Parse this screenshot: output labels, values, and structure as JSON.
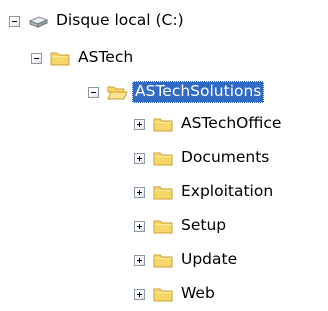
{
  "tree": {
    "root": {
      "label": "Disque local (C:)",
      "icon": "hard-drive-icon",
      "state": "expanded"
    },
    "astech": {
      "label": "ASTech",
      "icon": "folder-icon",
      "state": "expanded"
    },
    "astechsolutions": {
      "label": "ASTechSolutions",
      "icon": "open-folder-icon",
      "state": "expanded",
      "selected": true
    },
    "children": [
      {
        "label": "ASTechOffice",
        "icon": "folder-icon",
        "state": "collapsed"
      },
      {
        "label": "Documents",
        "icon": "folder-icon",
        "state": "collapsed"
      },
      {
        "label": "Exploitation",
        "icon": "folder-icon",
        "state": "collapsed"
      },
      {
        "label": "Setup",
        "icon": "folder-icon",
        "state": "collapsed"
      },
      {
        "label": "Update",
        "icon": "folder-icon",
        "state": "collapsed"
      },
      {
        "label": "Web",
        "icon": "folder-icon",
        "state": "collapsed"
      }
    ]
  },
  "colors": {
    "selection": "#316ac5",
    "folder_fill": "#f7d768",
    "folder_stroke": "#c8a23a"
  }
}
